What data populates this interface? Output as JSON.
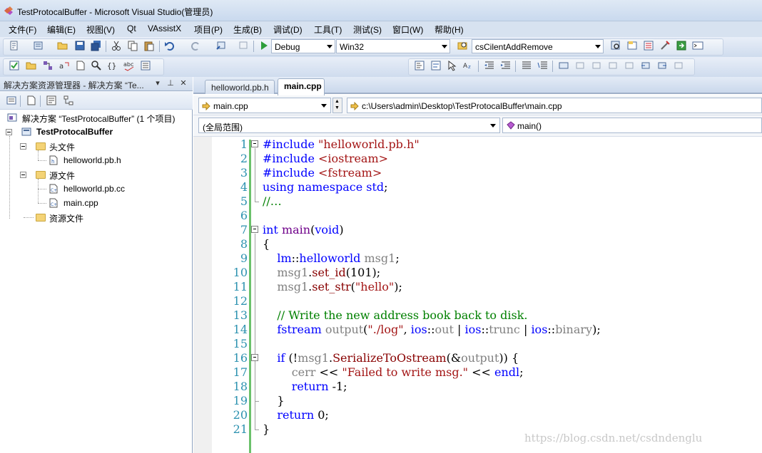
{
  "window": {
    "title": "TestProtocalBuffer - Microsoft Visual Studio(管理员)"
  },
  "menubar": {
    "items": [
      "文件(F)",
      "编辑(E)",
      "视图(V)",
      "Qt",
      "VAssistX",
      "项目(P)",
      "生成(B)",
      "调试(D)",
      "工具(T)",
      "测试(S)",
      "窗口(W)",
      "帮助(H)"
    ]
  },
  "toolbar": {
    "config_value": "Debug",
    "platform_value": "Win32",
    "find_value": "csCilentAddRemove"
  },
  "solution_explorer": {
    "title": "解决方案资源管理器 - 解决方案 “Te...",
    "pin_icon": "pin-icon",
    "close_icon": "close-icon",
    "solution_label": "解决方案 “TestProtocalBuffer” (1 个项目)",
    "project_label": "TestProtocalBuffer",
    "header_folder": "头文件",
    "header_file": "helloworld.pb.h",
    "source_folder": "源文件",
    "source_files": [
      "helloworld.pb.cc",
      "main.cpp"
    ],
    "resource_folder": "资源文件"
  },
  "editor": {
    "tabs": [
      {
        "label": "helloworld.pb.h",
        "active": false
      },
      {
        "label": "main.cpp",
        "active": true
      }
    ],
    "file_combo": "main.cpp",
    "path_combo": "c:\\Users\\admin\\Desktop\\TestProtocalBuffer\\main.cpp",
    "scope_combo": "(全局范围)",
    "member_combo": "main()",
    "line_numbers": [
      "1",
      "2",
      "3",
      "4",
      "5",
      "6",
      "7",
      "8",
      "9",
      "10",
      "11",
      "12",
      "13",
      "14",
      "15",
      "16",
      "17",
      "18",
      "19",
      "20",
      "21"
    ]
  },
  "watermark": "https://blog.csdn.net/csdndenglu",
  "colors": {
    "keyword": "#0000ff",
    "string": "#a31515",
    "comment": "#008000",
    "type": "#2b91af",
    "line_number": "#2b91af",
    "changebar": "#6bc16b"
  }
}
